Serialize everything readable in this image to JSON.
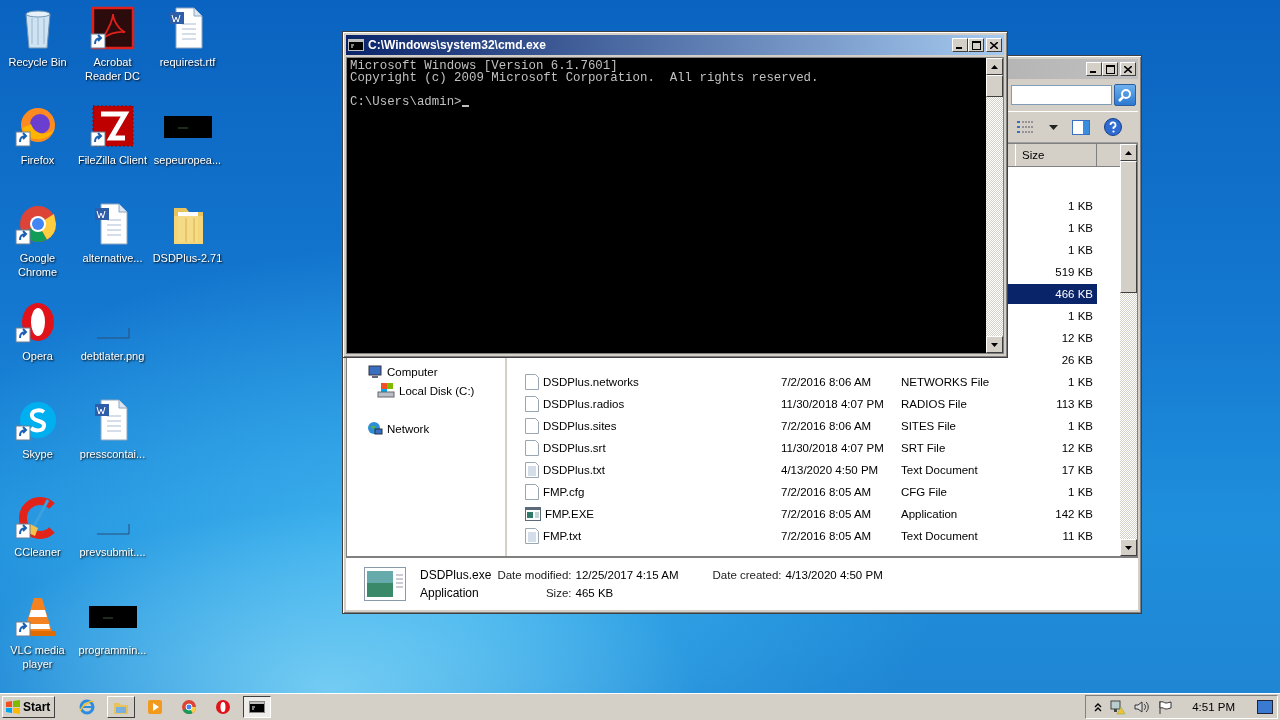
{
  "desktop_icons": [
    {
      "label": "Recycle Bin",
      "kind": "recycle",
      "shortcut": false
    },
    {
      "label": "Firefox",
      "kind": "firefox",
      "shortcut": true
    },
    {
      "label": "Google Chrome",
      "kind": "chrome",
      "shortcut": true
    },
    {
      "label": "Opera",
      "kind": "opera",
      "shortcut": true
    },
    {
      "label": "Skype",
      "kind": "skype",
      "shortcut": true
    },
    {
      "label": "CCleaner",
      "kind": "ccleaner",
      "shortcut": true
    },
    {
      "label": "VLC media player",
      "kind": "vlc",
      "shortcut": true
    },
    {
      "label": "Acrobat Reader DC",
      "kind": "acrobat",
      "shortcut": true
    },
    {
      "label": "FileZilla Client",
      "kind": "filezilla",
      "shortcut": true
    },
    {
      "label": "alternative...",
      "kind": "word",
      "shortcut": false
    },
    {
      "label": "debtlater.png",
      "kind": "blank",
      "shortcut": false
    },
    {
      "label": "presscontai...",
      "kind": "word",
      "shortcut": false
    },
    {
      "label": "prevsubmit....",
      "kind": "blank",
      "shortcut": false
    },
    {
      "label": "programmin...",
      "kind": "dark",
      "shortcut": false
    },
    {
      "label": "requirest.rtf",
      "kind": "word",
      "shortcut": false
    },
    {
      "label": "sepeuropea...",
      "kind": "dark",
      "shortcut": false
    },
    {
      "label": "DSDPlus-2.71",
      "kind": "folder",
      "shortcut": false
    }
  ],
  "explorer": {
    "columns": [
      {
        "label": "Size"
      }
    ],
    "nav": [
      {
        "label": "Computer",
        "kind": "computer",
        "children": [
          {
            "label": "Local Disk (C:)",
            "kind": "disk"
          }
        ]
      },
      {
        "label": "Network",
        "kind": "network"
      }
    ],
    "rows": [
      {
        "size": "1 KB",
        "selected": false
      },
      {
        "size": "1 KB",
        "selected": false
      },
      {
        "size": "1 KB",
        "selected": false
      },
      {
        "size": "519 KB",
        "selected": false
      },
      {
        "size": "466 KB",
        "selected": true
      },
      {
        "size": "1 KB",
        "selected": false
      },
      {
        "size": "12 KB",
        "selected": false
      },
      {
        "size": "26 KB",
        "selected": false
      },
      {
        "name": "DSDPlus.networks",
        "date": "7/2/2016 8:06 AM",
        "type": "NETWORKS File",
        "size": "1 KB",
        "kind": "file",
        "selected": false
      },
      {
        "name": "DSDPlus.radios",
        "date": "11/30/2018 4:07 PM",
        "type": "RADIOS File",
        "size": "113 KB",
        "kind": "file",
        "selected": false
      },
      {
        "name": "DSDPlus.sites",
        "date": "7/2/2016 8:06 AM",
        "type": "SITES File",
        "size": "1 KB",
        "kind": "file",
        "selected": false
      },
      {
        "name": "DSDPlus.srt",
        "date": "11/30/2018 4:07 PM",
        "type": "SRT File",
        "size": "12 KB",
        "kind": "file",
        "selected": false
      },
      {
        "name": "DSDPlus.txt",
        "date": "4/13/2020 4:50 PM",
        "type": "Text Document",
        "size": "17 KB",
        "kind": "text",
        "selected": false
      },
      {
        "name": "FMP.cfg",
        "date": "7/2/2016 8:05 AM",
        "type": "CFG File",
        "size": "1 KB",
        "kind": "file",
        "selected": false
      },
      {
        "name": "FMP.EXE",
        "date": "7/2/2016 8:05 AM",
        "type": "Application",
        "size": "142 KB",
        "kind": "app",
        "selected": false
      },
      {
        "name": "FMP.txt",
        "date": "7/2/2016 8:05 AM",
        "type": "Text Document",
        "size": "11 KB",
        "kind": "text",
        "selected": false
      }
    ],
    "details": {
      "name": "DSDPlus.exe",
      "type": "Application",
      "fields": [
        {
          "label": "Date modified:",
          "value": "12/25/2017 4:15 AM"
        },
        {
          "label": "Date created:",
          "value": "4/13/2020 4:50 PM"
        },
        {
          "label": "Size:",
          "value": "465 KB"
        }
      ]
    }
  },
  "cmd_window": {
    "title": "C:\\Windows\\system32\\cmd.exe",
    "output": [
      "Microsoft Windows [Version 6.1.7601]",
      "Copyright (c) 2009 Microsoft Corporation.  All rights reserved."
    ],
    "prompt": "C:\\Users\\admin>"
  },
  "taskbar": {
    "start": "Start",
    "apps": [
      {
        "kind": "ie",
        "running": false,
        "selected": false
      },
      {
        "kind": "explorer",
        "running": true,
        "selected": false
      },
      {
        "kind": "media",
        "running": false,
        "selected": false
      },
      {
        "kind": "chrome",
        "running": false,
        "selected": false
      },
      {
        "kind": "opera",
        "running": false,
        "selected": false
      },
      {
        "kind": "cmd",
        "running": true,
        "selected": true
      }
    ],
    "clock": "4:51 PM"
  }
}
